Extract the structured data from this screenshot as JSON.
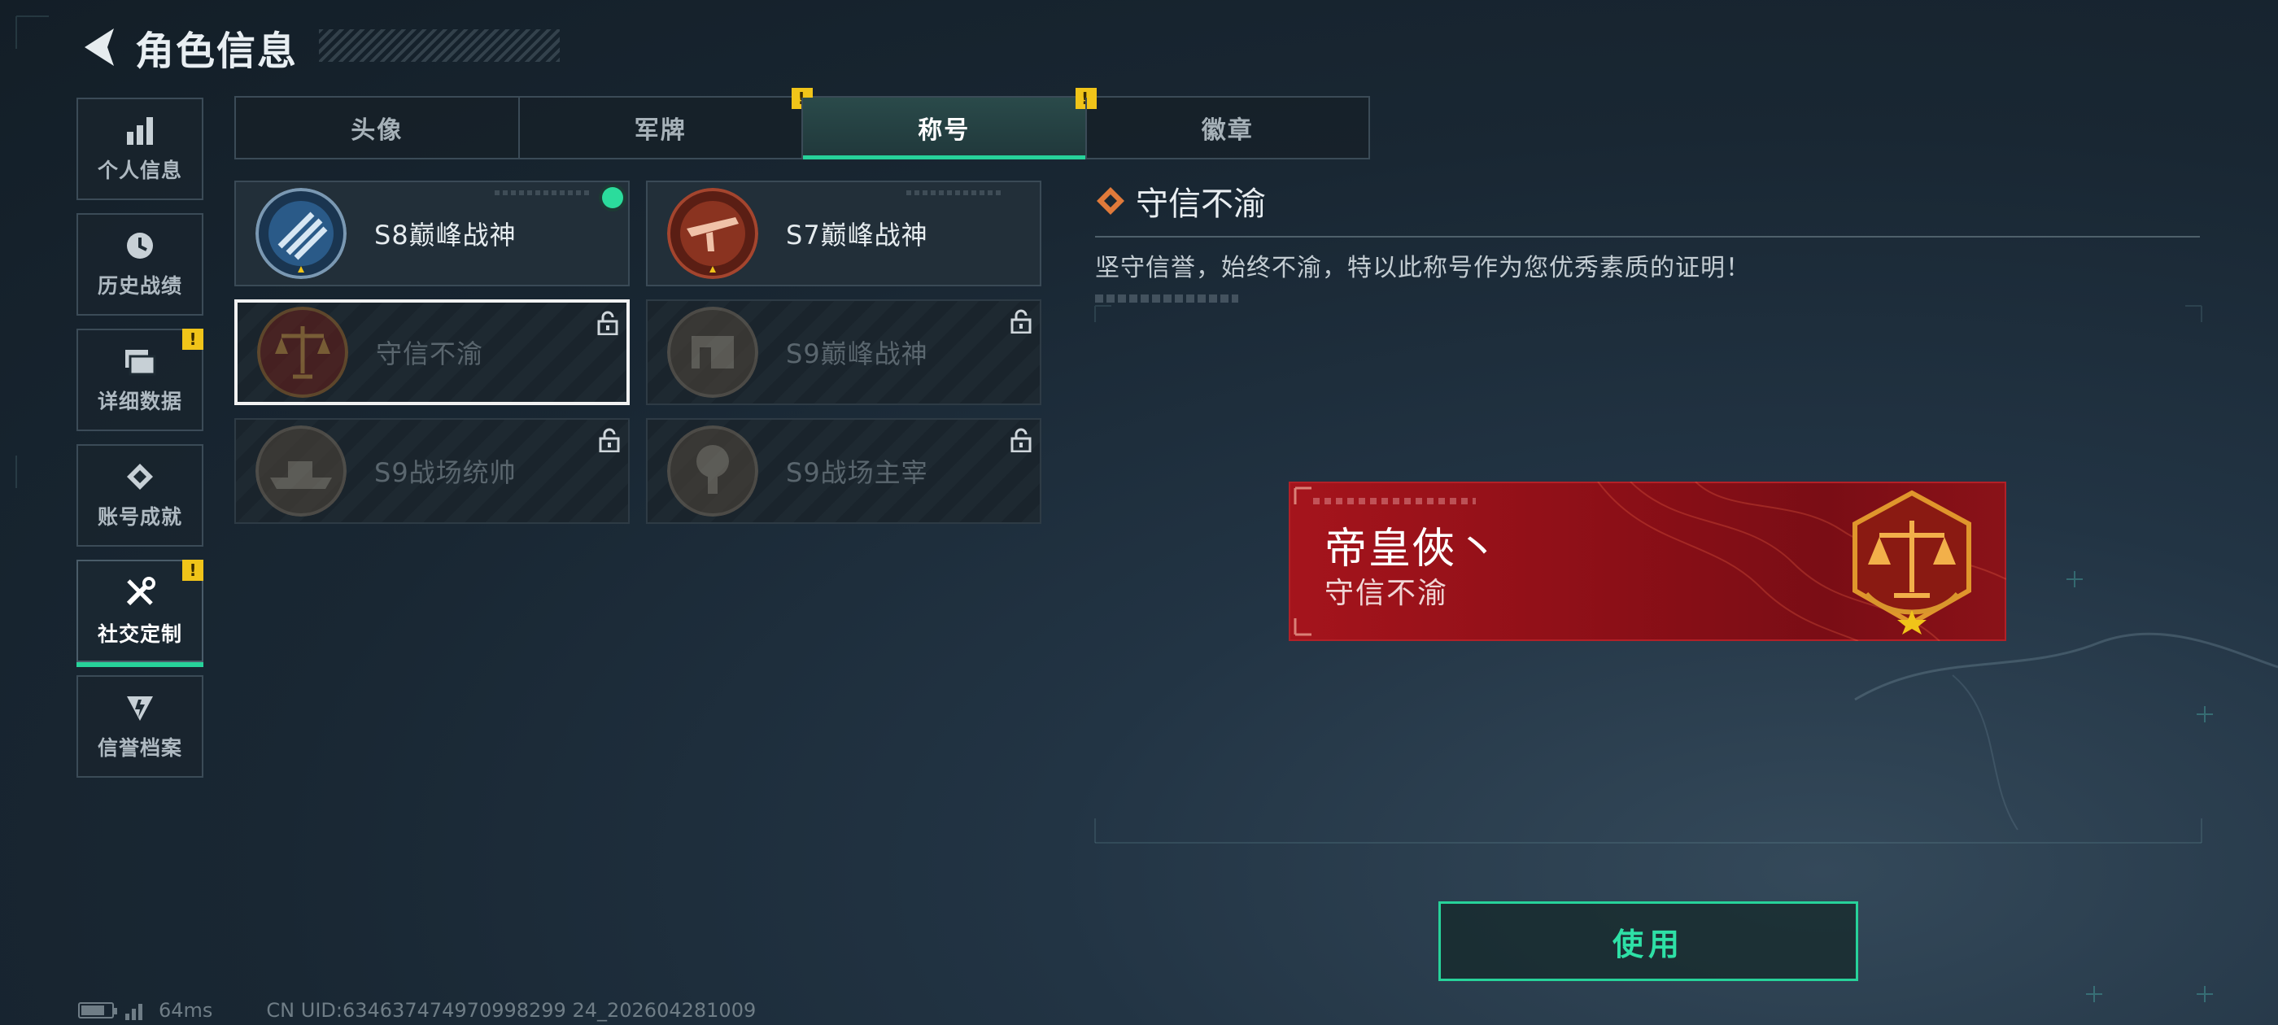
{
  "header": {
    "title": "角色信息"
  },
  "sidebar": {
    "items": [
      {
        "label": "个人信息",
        "icon": "bar-chart-icon",
        "badge": ""
      },
      {
        "label": "历史战绩",
        "icon": "history-icon",
        "badge": ""
      },
      {
        "label": "详细数据",
        "icon": "folder-icon",
        "badge": "!"
      },
      {
        "label": "账号成就",
        "icon": "achievement-icon",
        "badge": ""
      },
      {
        "label": "社交定制",
        "icon": "tools-icon",
        "badge": "!",
        "active": true
      },
      {
        "label": "信誉档案",
        "icon": "credit-icon",
        "badge": ""
      }
    ]
  },
  "tabs": [
    {
      "label": "头像",
      "badge": ""
    },
    {
      "label": "军牌",
      "badge": "!"
    },
    {
      "label": "称号",
      "badge": "!",
      "active": true
    },
    {
      "label": "徽章",
      "badge": ""
    }
  ],
  "titles": [
    {
      "name": "S8巅峰战神",
      "locked": false,
      "equipped": true
    },
    {
      "name": "S7巅峰战神",
      "locked": false,
      "equipped": false
    },
    {
      "name": "守信不渝",
      "locked": true,
      "selected": true
    },
    {
      "name": "S9巅峰战神",
      "locked": true
    },
    {
      "name": "S9战场统帅",
      "locked": true
    },
    {
      "name": "S9战场主宰",
      "locked": true
    }
  ],
  "detail": {
    "title": "守信不渝",
    "description": "坚守信誉，始终不渝，特以此称号作为您优秀素质的证明！"
  },
  "banner": {
    "player_name": "帝皇俠丶",
    "title": "守信不渝"
  },
  "actions": {
    "use_label": "使用"
  },
  "status": {
    "ping": "64ms",
    "uid": "CN UID:634637474970998299 24_202604281009"
  },
  "colors": {
    "accent": "#27d29a",
    "badge": "#f0c419",
    "banner": "#a5141c"
  }
}
